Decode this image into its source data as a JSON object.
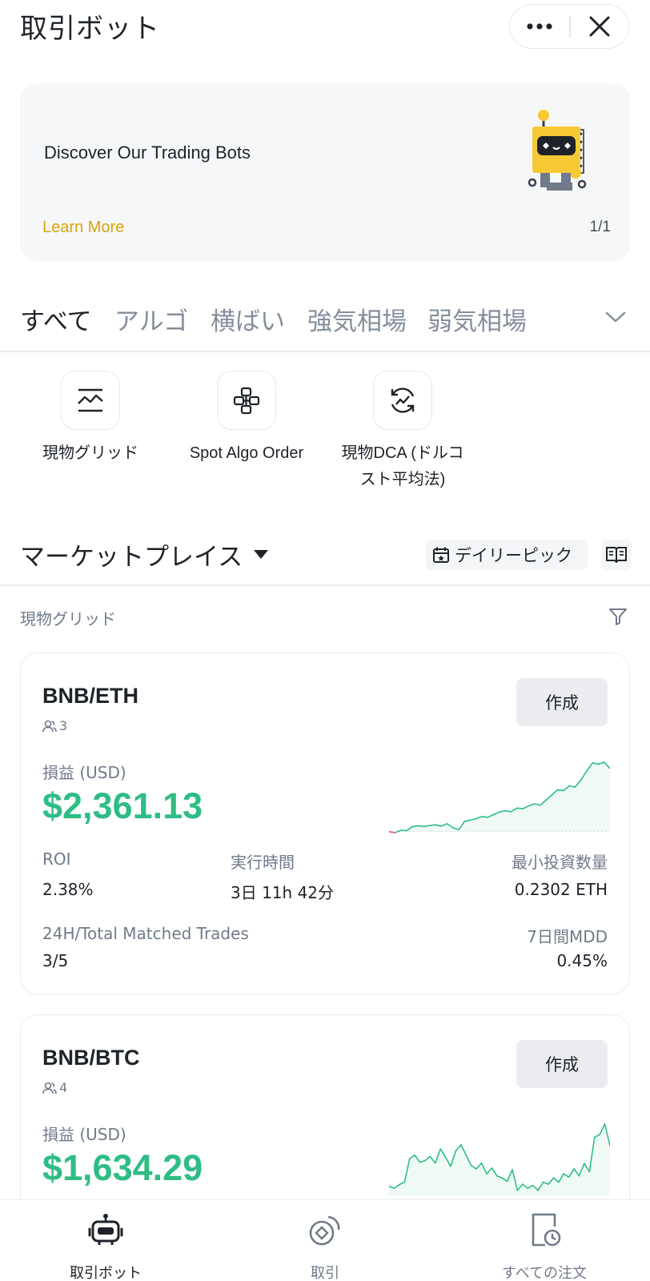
{
  "header": {
    "title": "取引ボット"
  },
  "banner": {
    "title": "Discover Our Trading Bots",
    "link": "Learn More",
    "page": "1/1"
  },
  "tabs": [
    "すべて",
    "アルゴ",
    "横ばい",
    "強気相場",
    "弱気相場"
  ],
  "bot_types": [
    {
      "label": "現物グリッド",
      "icon": "grid-chart-icon"
    },
    {
      "label": "Spot Algo Order",
      "icon": "algo-flow-icon"
    },
    {
      "label_line1": "現物DCA (ドルコ",
      "label_line2": "スト平均法)",
      "icon": "dca-cycle-icon"
    }
  ],
  "marketplace": {
    "title": "マーケットプレイス",
    "daily_pick": "デイリーピック",
    "filter_label": "現物グリッド"
  },
  "cards": [
    {
      "pair": "BNB/ETH",
      "users": "3",
      "create": "作成",
      "pnl_label": "損益 (USD)",
      "pnl": "$2,361.13",
      "roi_label": "ROI",
      "roi": "2.38%",
      "runtime_label": "実行時間",
      "runtime": "3日 11h 42分",
      "min_label": "最小投資数量",
      "min": "0.2302 ETH",
      "trades_label": "24H/Total Matched Trades",
      "trades": "3/5",
      "mdd_label": "7日間MDD",
      "mdd": "0.45%",
      "spark": [
        0.0,
        -0.3,
        0.4,
        0.3,
        1.5,
        1.8,
        1.6,
        1.9,
        2.1,
        1.7,
        2.4,
        1.2,
        0.6,
        3.2,
        3.5,
        4.0,
        4.6,
        4.4,
        5.2,
        6.0,
        6.4,
        6.1,
        7.2,
        7.0,
        7.8,
        8.5,
        8.1,
        9.6,
        11.2,
        12.8,
        12.5,
        14.0,
        13.6,
        15.8,
        18.5,
        21.0,
        20.6,
        21.2,
        19.3
      ]
    },
    {
      "pair": "BNB/BTC",
      "users": "4",
      "create": "作成",
      "pnl_label": "損益 (USD)",
      "pnl": "$1,634.29",
      "spark": [
        2.0,
        1.5,
        2.4,
        3.0,
        8.6,
        9.5,
        7.8,
        8.2,
        9.2,
        7.6,
        11.0,
        9.0,
        6.8,
        10.5,
        12.0,
        9.5,
        7.0,
        6.2,
        7.6,
        5.0,
        6.4,
        4.5,
        4.0,
        3.2,
        6.0,
        1.0,
        2.5,
        1.5,
        2.2,
        1.0,
        3.0,
        2.5,
        4.0,
        3.0,
        5.0,
        4.2,
        6.2,
        4.5,
        7.5,
        5.5,
        13.8,
        14.5,
        17.0,
        11.8
      ]
    }
  ],
  "nav": [
    {
      "label": "取引ボット",
      "icon": "robot-icon"
    },
    {
      "label": "取引",
      "icon": "trade-icon"
    },
    {
      "label": "すべての注文",
      "icon": "orders-clock-icon"
    }
  ],
  "colors": {
    "green": "#2ebd85",
    "red": "#f6465d",
    "gold": "#d9a40a"
  }
}
